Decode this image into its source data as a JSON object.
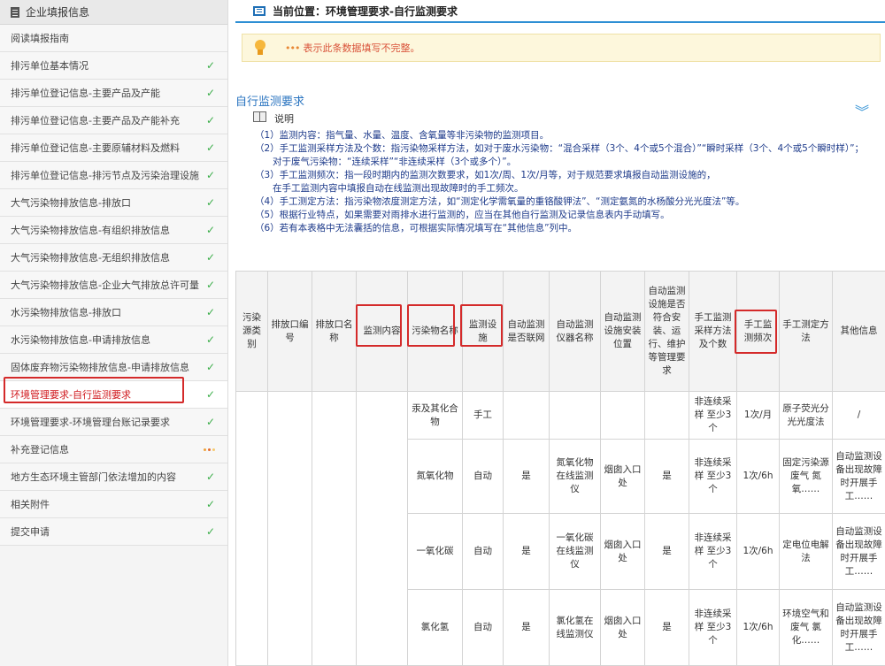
{
  "sidebar": {
    "header": "企业填报信息",
    "items": [
      {
        "label": "阅读填报指南",
        "status": "none"
      },
      {
        "label": "排污单位基本情况",
        "status": "check"
      },
      {
        "label": "排污单位登记信息-主要产品及产能",
        "status": "check"
      },
      {
        "label": "排污单位登记信息-主要产品及产能补充",
        "status": "check"
      },
      {
        "label": "排污单位登记信息-主要原辅材料及燃料",
        "status": "check"
      },
      {
        "label": "排污单位登记信息-排污节点及污染治理设施",
        "status": "check"
      },
      {
        "label": "大气污染物排放信息-排放口",
        "status": "check"
      },
      {
        "label": "大气污染物排放信息-有组织排放信息",
        "status": "check"
      },
      {
        "label": "大气污染物排放信息-无组织排放信息",
        "status": "check"
      },
      {
        "label": "大气污染物排放信息-企业大气排放总许可量",
        "status": "check"
      },
      {
        "label": "水污染物排放信息-排放口",
        "status": "check"
      },
      {
        "label": "水污染物排放信息-申请排放信息",
        "status": "check"
      },
      {
        "label": "固体废弃物污染物排放信息-申请排放信息",
        "status": "check"
      },
      {
        "label": "环境管理要求-自行监测要求",
        "status": "check",
        "active": true
      },
      {
        "label": "环境管理要求-环境管理台账记录要求",
        "status": "check"
      },
      {
        "label": "补充登记信息",
        "status": "dots"
      },
      {
        "label": "地方生态环境主管部门依法增加的内容",
        "status": "check"
      },
      {
        "label": "相关附件",
        "status": "check"
      },
      {
        "label": "提交申请",
        "status": "check"
      }
    ],
    "check_glyph": "✓",
    "check_color": "#3cae4a",
    "active_color": "#d0191e",
    "highlight_color": "#d42a2a"
  },
  "main": {
    "location": "当前位置：环境管理要求-自行监测要求",
    "warning": "表示此条数据填写不完整。",
    "section_title": "自行监测要求",
    "explain_label": "说明",
    "collapse_glyph": "︾",
    "notes": [
      "（1）监测内容：指气量、水量、温度、含氧量等非污染物的监测项目。",
      "（2）手工监测采样方法及个数：指污染物采样方法，如对于废水污染物：“混合采样（3个、4个或5个混合）”“瞬时采样（3个、4个或5个瞬时样）”；",
      "对于废气污染物：“连续采样”“非连续采样（3个或多个）”。",
      "（3）手工监测频次：指一段时期内的监测次数要求，如1次/周、1次/月等，对于规范要求填报自动监测设施的，",
      "在手工监测内容中填报自动在线监测出现故障时的手工频次。",
      "（4）手工测定方法：指污染物浓度测定方法，如“测定化学需氧量的重铬酸钾法”、“测定氨氮的水杨酸分光光度法”等。",
      "（5）根据行业特点，如果需要对雨排水进行监测的，应当在其他自行监测及记录信息表内手动填写。",
      "（6）若有本表格中无法囊括的信息，可根据实际情况填写在“其他信息”列中。"
    ],
    "table": {
      "headers": [
        "污染源类别",
        "排放口编号",
        "排放口名称",
        "监测内容",
        "污染物名称",
        "监测设施",
        "自动监测是否联网",
        "自动监测仪器名称",
        "自动监测设施安装位置",
        "自动监测设施是否符合安装、运行、维护等管理要求",
        "手工监测采样方法及个数",
        "手工监测频次",
        "手工测定方法",
        "其他信息"
      ],
      "rows": [
        [
          "",
          "",
          "",
          "",
          "汞及其化合物",
          "手工",
          "",
          "",
          "",
          "",
          "非连续采样 至少3个",
          "1次/月",
          "原子荧光分光光度法",
          "/"
        ],
        [
          "",
          "",
          "",
          "",
          "氮氧化物",
          "自动",
          "是",
          "氮氧化物在线监测仪",
          "烟囱入口处",
          "是",
          "非连续采样 至少3个",
          "1次/6h",
          "固定污染源废气 氮氧……",
          "自动监测设备出现故障时开展手工……"
        ],
        [
          "",
          "",
          "",
          "",
          "一氧化碳",
          "自动",
          "是",
          "一氧化碳在线监测仪",
          "烟囱入口处",
          "是",
          "非连续采样 至少3个",
          "1次/6h",
          "定电位电解法",
          "自动监测设备出现故障时开展手工……"
        ],
        [
          "",
          "",
          "",
          "",
          "氯化氢",
          "自动",
          "是",
          "氯化氢在线监测仪",
          "烟囱入口处",
          "是",
          "非连续采样 至少3个",
          "1次/6h",
          "环境空气和废气 氯化……",
          "自动监测设备出现故障时开展手工……"
        ]
      ]
    }
  }
}
